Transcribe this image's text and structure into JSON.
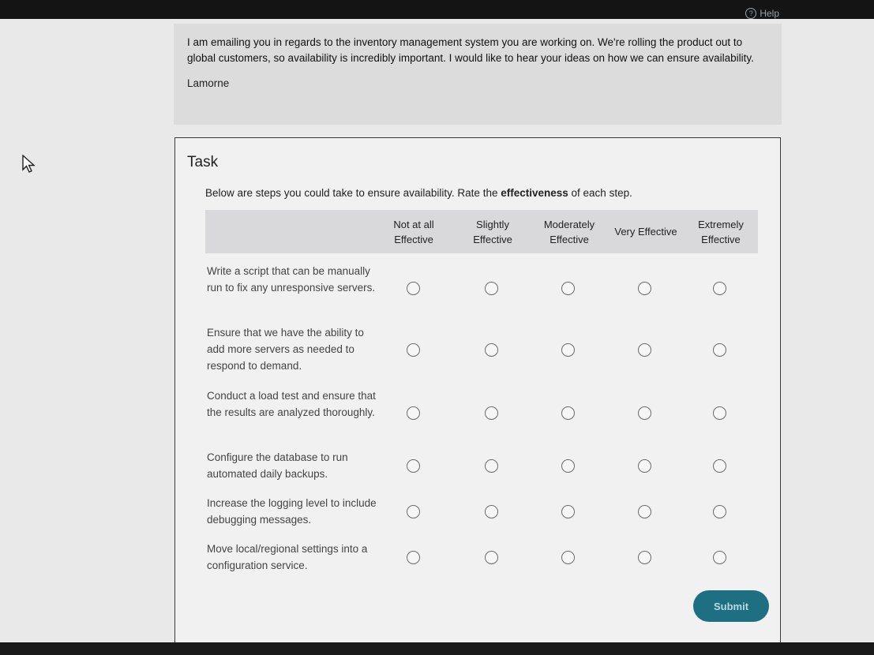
{
  "header": {
    "help_label": "Help",
    "help_icon": "question-circle-icon"
  },
  "email": {
    "body": "I am emailing you in regards to the inventory management system you are working on. We're rolling the product out to global customers, so availability is incredibly important. I would like to hear your ideas on how we can ensure availability.",
    "signature": "Lamorne"
  },
  "task": {
    "title": "Task",
    "instruction_prefix": "Below are steps you could take to ensure availability. Rate the ",
    "instruction_emphasis": "effectiveness",
    "instruction_suffix": " of each step.",
    "columns": [
      {
        "line1": "Not at all",
        "line2": "Effective"
      },
      {
        "line1": "Slightly",
        "line2": "Effective"
      },
      {
        "line1": "Moderately",
        "line2": "Effective"
      },
      {
        "line1": "Very Effective",
        "line2": ""
      },
      {
        "line1": "Extremely",
        "line2": "Effective"
      }
    ],
    "rows": [
      {
        "label": "Write a script that can be manually run to fix any unresponsive servers."
      },
      {
        "label": "Ensure that we have the ability to add more servers as needed to respond to demand."
      },
      {
        "label": "Conduct a load test and ensure that the results are analyzed thoroughly."
      },
      {
        "label": "Configure the database to run automated daily backups."
      },
      {
        "label": "Increase the logging level to include debugging messages."
      },
      {
        "label": "Move local/regional settings into a configuration service."
      }
    ],
    "submit_label": "Submit"
  },
  "colors": {
    "accent": "#1f6f82",
    "background": "#e9e9ea"
  }
}
